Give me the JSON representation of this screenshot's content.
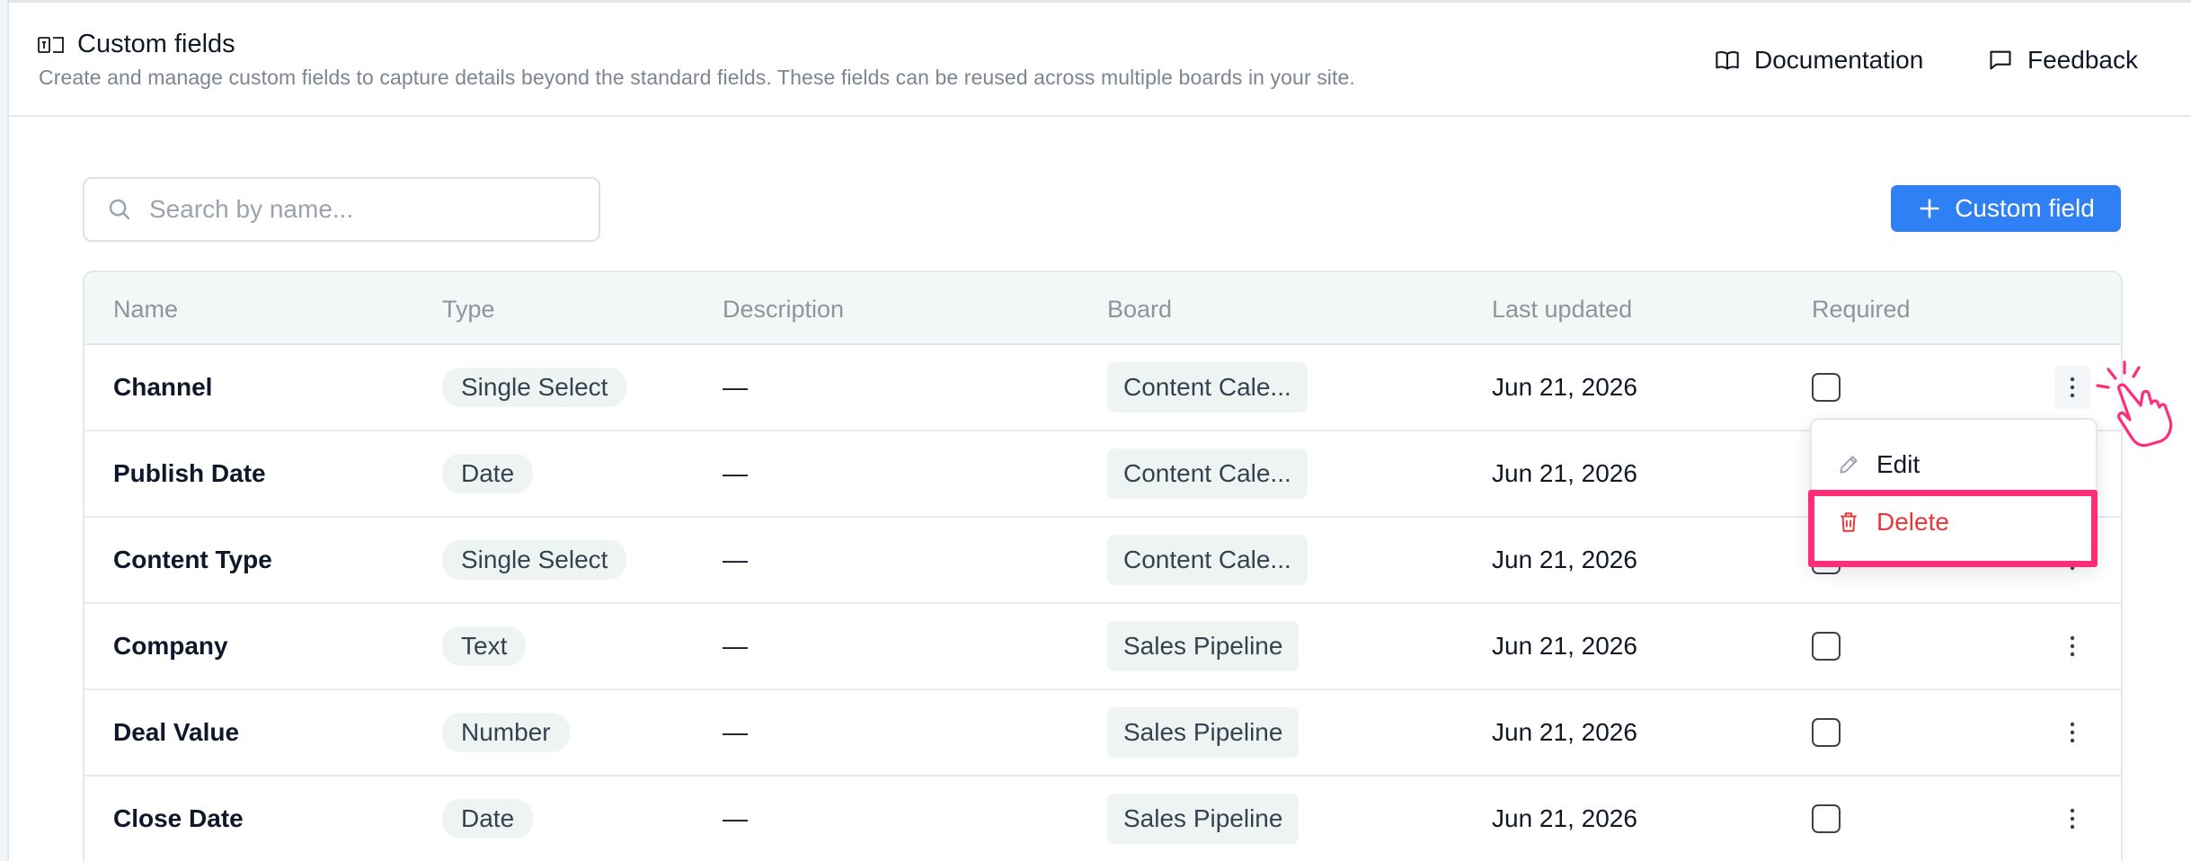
{
  "header": {
    "title": "Custom fields",
    "subtitle": "Create and manage custom fields to capture details beyond the standard fields. These fields can be reused across multiple boards in your site.",
    "documentation_label": "Documentation",
    "feedback_label": "Feedback"
  },
  "search": {
    "placeholder": "Search by name...",
    "value": ""
  },
  "add_button": {
    "label": "Custom field"
  },
  "table": {
    "columns": [
      "Name",
      "Type",
      "Description",
      "Board",
      "Last updated",
      "Required"
    ],
    "rows": [
      {
        "name": "Channel",
        "type": "Single Select",
        "description": "—",
        "board": "Content Cale...",
        "updated": "Jun 21, 2026",
        "required": false
      },
      {
        "name": "Publish Date",
        "type": "Date",
        "description": "—",
        "board": "Content Cale...",
        "updated": "Jun 21, 2026",
        "required": false
      },
      {
        "name": "Content Type",
        "type": "Single Select",
        "description": "—",
        "board": "Content Cale...",
        "updated": "Jun 21, 2026",
        "required": false
      },
      {
        "name": "Company",
        "type": "Text",
        "description": "—",
        "board": "Sales Pipeline",
        "updated": "Jun 21, 2026",
        "required": false
      },
      {
        "name": "Deal Value",
        "type": "Number",
        "description": "—",
        "board": "Sales Pipeline",
        "updated": "Jun 21, 2026",
        "required": false
      },
      {
        "name": "Close Date",
        "type": "Date",
        "description": "—",
        "board": "Sales Pipeline",
        "updated": "Jun 21, 2026",
        "required": false
      }
    ]
  },
  "menu": {
    "edit_label": "Edit",
    "delete_label": "Delete"
  },
  "colors": {
    "accent": "#2f7ff5",
    "danger": "#e23a3a",
    "highlight": "#ff2d78"
  },
  "icons": [
    "fields-icon",
    "book-icon",
    "message-icon",
    "search-icon",
    "plus-icon",
    "kebab-icon",
    "pencil-icon",
    "trash-icon",
    "tap-hand-icon"
  ]
}
